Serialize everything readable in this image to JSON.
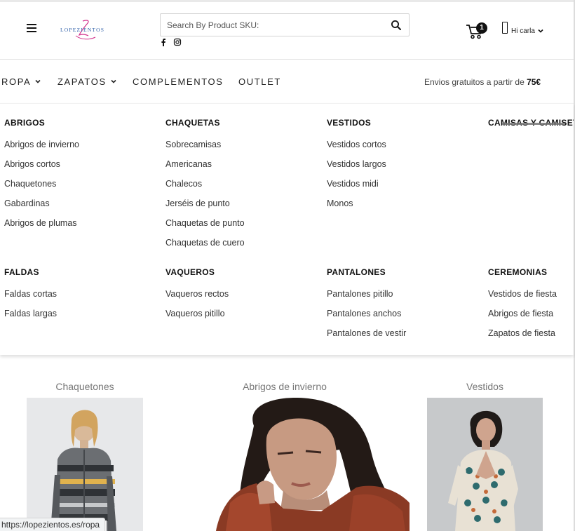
{
  "search": {
    "placeholder": "Search By Product SKU:"
  },
  "header": {
    "logo_text": "LOPEZIENTOS",
    "cart_count": "1",
    "user_label": "Hi carla"
  },
  "nav": {
    "items": [
      {
        "label": "ROPA",
        "has_dropdown": true
      },
      {
        "label": "ZAPATOS",
        "has_dropdown": true
      },
      {
        "label": "COMPLEMENTOS",
        "has_dropdown": false
      },
      {
        "label": "OUTLET",
        "has_dropdown": false
      }
    ],
    "shipping_text": "Envios gratuitos a partir de ",
    "shipping_amount": "75€"
  },
  "mega_menu": {
    "columns": [
      {
        "title": "ABRIGOS",
        "links": [
          "Abrigos de invierno",
          "Abrigos cortos",
          "Chaquetones",
          "Gabardinas",
          "Abrigos de plumas"
        ]
      },
      {
        "title": "CHAQUETAS",
        "links": [
          "Sobrecamisas",
          "Americanas",
          "Chalecos",
          "Jerséis de punto",
          "Chaquetas de punto",
          "Chaquetas de cuero"
        ]
      },
      {
        "title": "VESTIDOS",
        "links": [
          "Vestidos cortos",
          "Vestidos largos",
          "Vestidos midi",
          "Monos"
        ]
      },
      {
        "title": "CAMISAS Y CAMISETA",
        "links": []
      },
      {
        "title": "FALDAS",
        "links": [
          "Faldas cortas",
          "Faldas largas"
        ]
      },
      {
        "title": "VAQUEROS",
        "links": [
          "Vaqueros rectos",
          "Vaqueros pitillo"
        ]
      },
      {
        "title": "PANTALONES",
        "links": [
          "Pantalones pitillo",
          "Pantalones anchos",
          "Pantalones de vestir"
        ]
      },
      {
        "title": "CEREMONIAS",
        "links": [
          "Vestidos de fiesta",
          "Abrigos de fiesta",
          "Zapatos de fiesta"
        ]
      }
    ]
  },
  "tiles": [
    {
      "label": "Chaquetones"
    },
    {
      "label": "Abrigos de invierno"
    },
    {
      "label": "Vestidos"
    }
  ],
  "status_url": "https://lopezientos.es/ropa",
  "colors": {
    "logo_blue": "#2e5fa8",
    "logo_pink": "#d4338e",
    "text": "#222222",
    "muted": "#777777"
  }
}
